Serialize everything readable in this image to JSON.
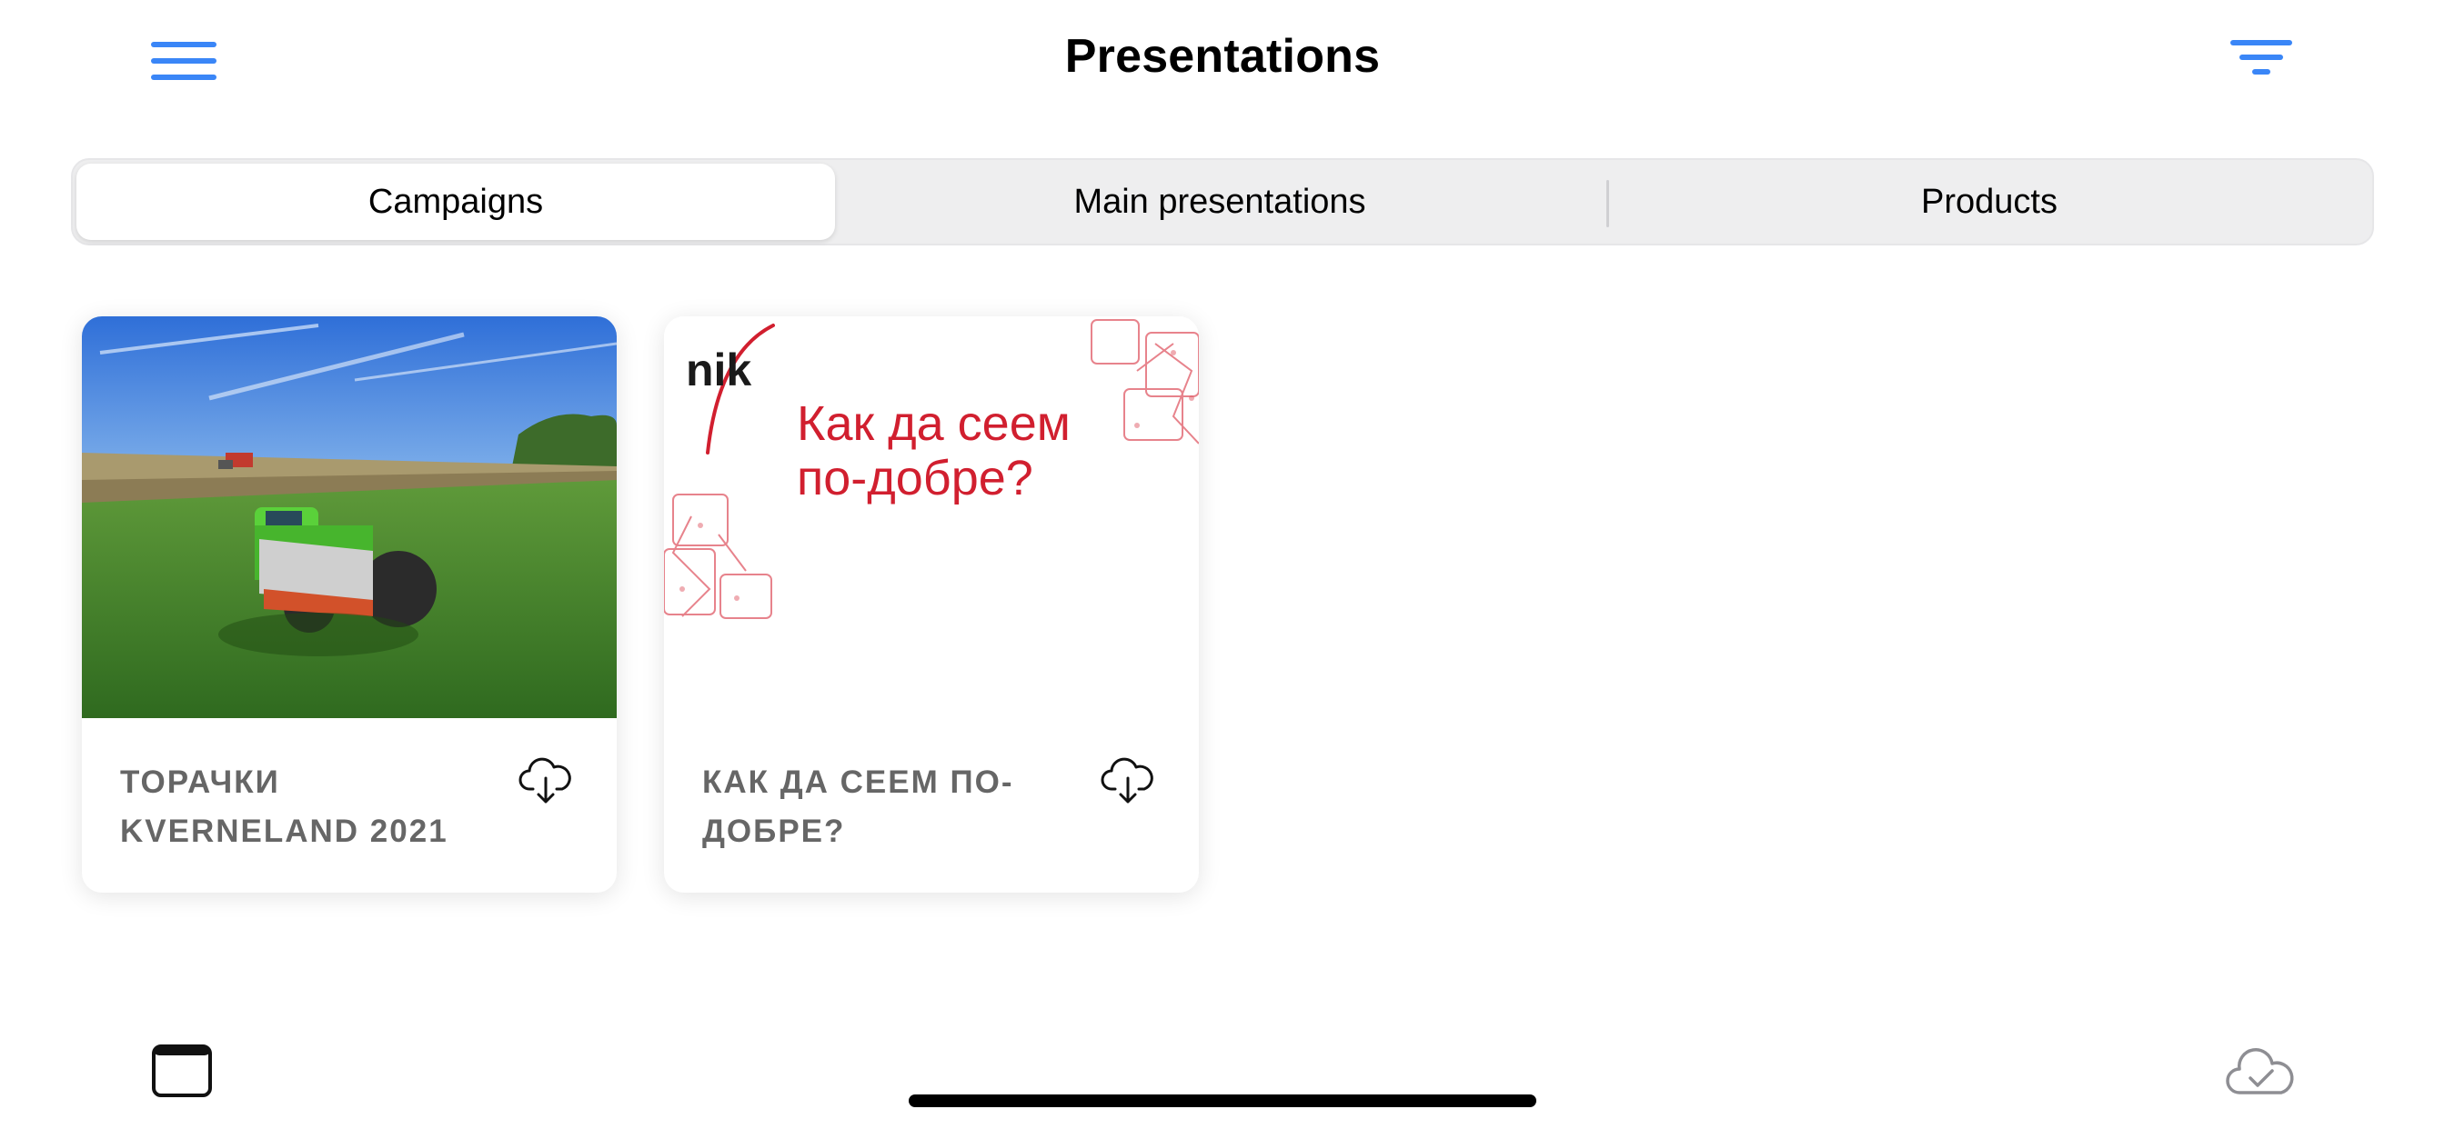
{
  "header": {
    "title": "Presentations",
    "menu_icon": "hamburger-menu-icon",
    "filter_icon": "filter-icon"
  },
  "tabs": [
    {
      "label": "Campaigns",
      "selected": true
    },
    {
      "label": "Main presentations",
      "selected": false
    },
    {
      "label": "Products",
      "selected": false
    }
  ],
  "cards": [
    {
      "title": "ТОРАЧКИ KVERNELAND 2021",
      "thumbnail": "tractor-field-photo",
      "action_icon": "cloud-download-icon"
    },
    {
      "title": "КАК ДА СЕЕМ ПО-ДОБРЕ?",
      "thumbnail": "nik-cover",
      "thumb_logo": "nik",
      "thumb_line1": "Как да сеем",
      "thumb_line2": "по-добре?",
      "action_icon": "cloud-download-icon"
    }
  ],
  "bottom": {
    "left_icon": "window-icon",
    "right_icon": "cloud-check-icon"
  },
  "colors": {
    "accent": "#3a86f7",
    "card_title": "#666666",
    "nik_red": "#d11f2f"
  }
}
